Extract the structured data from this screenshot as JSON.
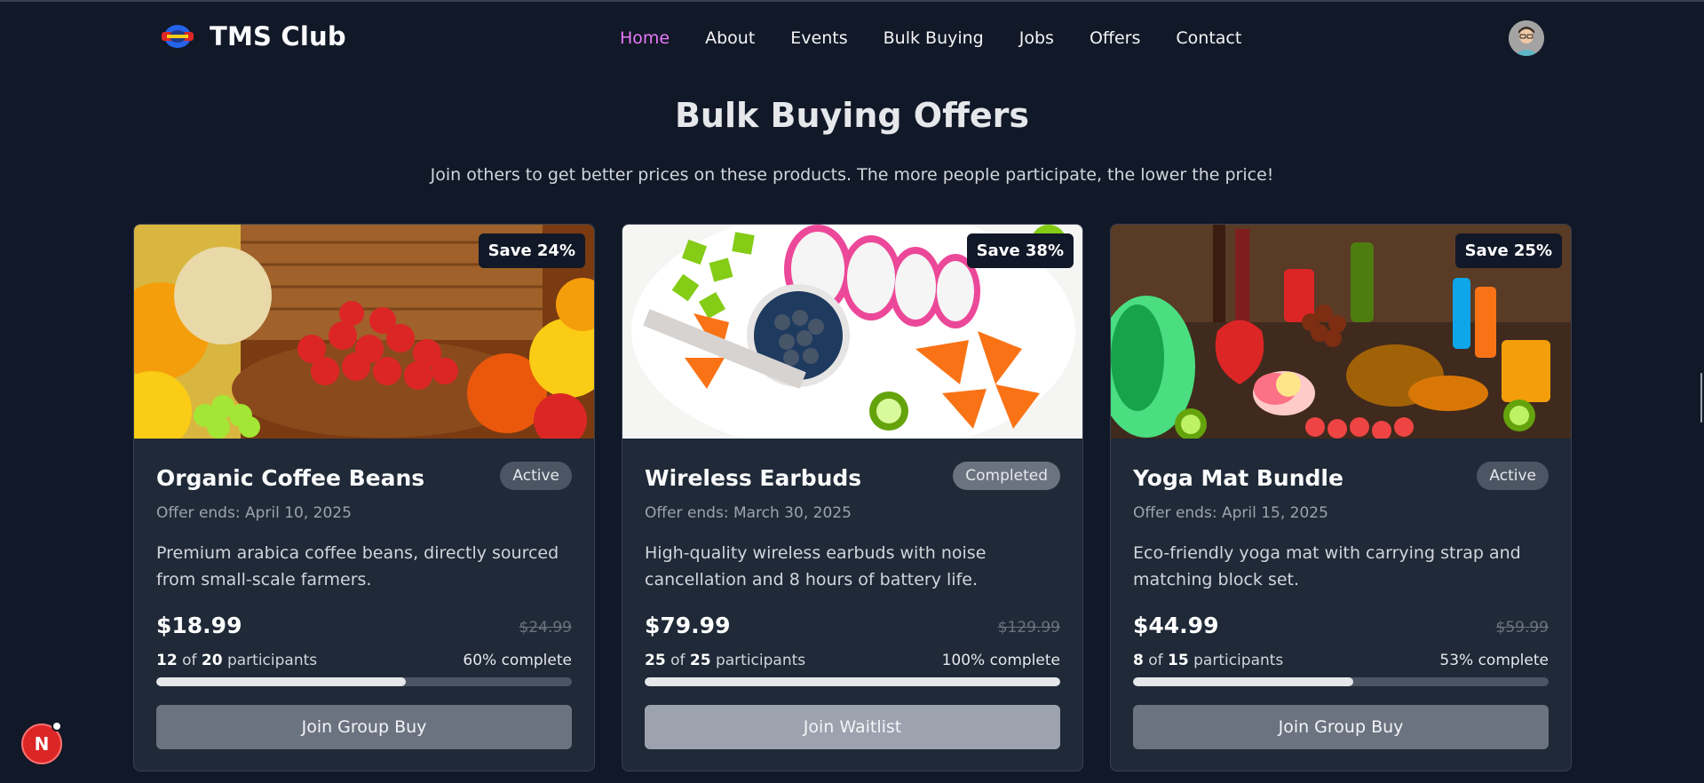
{
  "brand": {
    "name": "TMS Club",
    "logo_icon": "club-badge-icon"
  },
  "nav": {
    "items": [
      {
        "label": "Home",
        "active": true
      },
      {
        "label": "About"
      },
      {
        "label": "Events"
      },
      {
        "label": "Bulk Buying"
      },
      {
        "label": "Jobs"
      },
      {
        "label": "Offers"
      },
      {
        "label": "Contact"
      }
    ],
    "active_color": "#e879f9"
  },
  "page": {
    "title": "Bulk Buying Offers",
    "subtitle": "Join others to get better prices on these products. The more people participate, the lower the price!"
  },
  "offers": [
    {
      "save": "Save 24%",
      "image": "fruit-basket-photo",
      "name": "Organic Coffee Beans",
      "status": "Active",
      "ends": "Offer ends: April 10, 2025",
      "description": "Premium arabica coffee beans, directly sourced from small-scale farmers.",
      "price": "$18.99",
      "original_price": "$24.99",
      "current": "12",
      "of": "of",
      "target": "20",
      "participants_label": "participants",
      "complete": "60% complete",
      "progress": 0.6,
      "button": "Join Group Buy"
    },
    {
      "save": "Save 38%",
      "image": "fruit-platter-photo",
      "name": "Wireless Earbuds",
      "status": "Completed",
      "ends": "Offer ends: March 30, 2025",
      "description": "High-quality wireless earbuds with noise cancellation and 8 hours of battery life.",
      "price": "$79.99",
      "original_price": "$129.99",
      "current": "25",
      "of": "of",
      "target": "25",
      "participants_label": "participants",
      "complete": "100% complete",
      "progress": 1.0,
      "button": "Join Waitlist"
    },
    {
      "save": "Save 25%",
      "image": "grocery-assortment-photo",
      "name": "Yoga Mat Bundle",
      "status": "Active",
      "ends": "Offer ends: April 15, 2025",
      "description": "Eco-friendly yoga mat with carrying strap and matching block set.",
      "price": "$44.99",
      "original_price": "$59.99",
      "current": "8",
      "of": "of",
      "target": "15",
      "participants_label": "participants",
      "complete": "53% complete",
      "progress": 0.53,
      "button": "Join Group Buy"
    }
  ],
  "floating": {
    "letter": "N"
  }
}
